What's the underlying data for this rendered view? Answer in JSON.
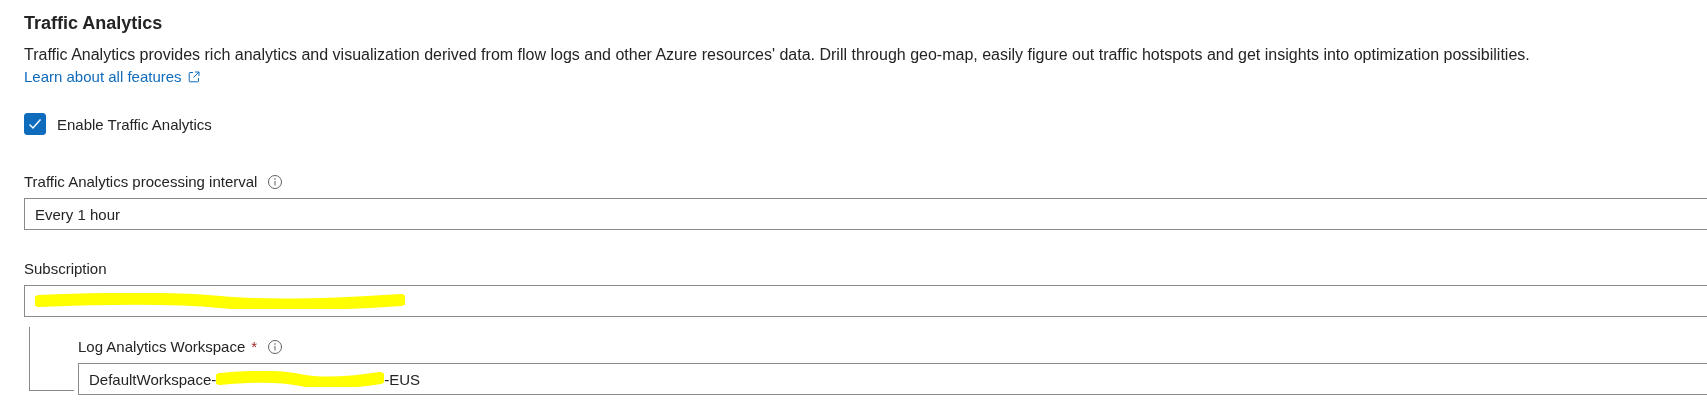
{
  "section": {
    "title": "Traffic Analytics",
    "description": "Traffic Analytics provides rich analytics and visualization derived from flow logs and other Azure resources' data. Drill through geo-map, easily figure out traffic hotspots and get insights into optimization possibilities.",
    "link": "Learn about all features"
  },
  "enable_checkbox": {
    "label": "Enable Traffic Analytics",
    "checked": true
  },
  "fields": [
    {
      "label": "Traffic Analytics processing interval",
      "info": true,
      "nested": false,
      "value_parts": [
        "Every 1 hour"
      ],
      "redacted": false
    },
    {
      "label": "Subscription",
      "info": false,
      "nested": false,
      "redacted": true
    },
    {
      "label": "Log Analytics Workspace",
      "required_mark": "*",
      "info": true,
      "nested": true,
      "value_parts": [
        "DefaultWorkspace-",
        "-EUS"
      ],
      "redacted": true
    }
  ]
}
